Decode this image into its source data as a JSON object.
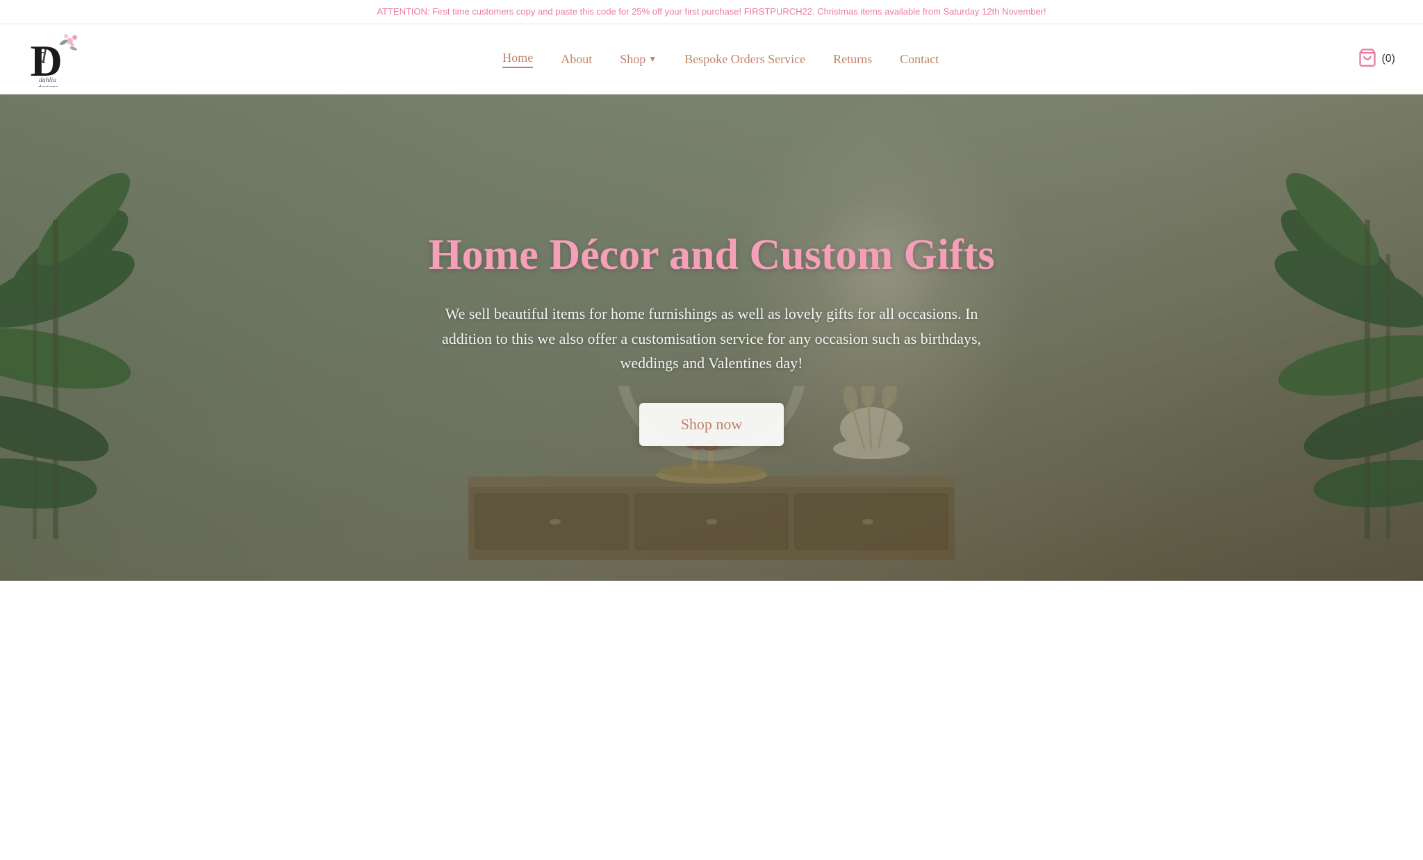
{
  "announcement": {
    "text": "ATTENTION: First time customers copy and paste this code for 25% off your first purchase! FIRSTPURCH22. Christmas items available from Saturday 12th November!"
  },
  "header": {
    "logo_text": "dahlia designs",
    "nav": [
      {
        "label": "Home",
        "active": true,
        "id": "home"
      },
      {
        "label": "About",
        "active": false,
        "id": "about"
      },
      {
        "label": "Shop",
        "active": false,
        "id": "shop",
        "has_dropdown": true
      },
      {
        "label": "Bespoke Orders Service",
        "active": false,
        "id": "bespoke"
      },
      {
        "label": "Returns",
        "active": false,
        "id": "returns"
      },
      {
        "label": "Contact",
        "active": false,
        "id": "contact"
      }
    ],
    "cart": {
      "count": "(0)"
    }
  },
  "hero": {
    "title": "Home Décor and Custom Gifts",
    "subtitle": "We sell beautiful items for home furnishings as well as lovely gifts for all occasions. In addition to this we also offer a customisation service for any occasion such as birthdays, weddings and Valentines day!",
    "cta_button": "Shop now"
  }
}
